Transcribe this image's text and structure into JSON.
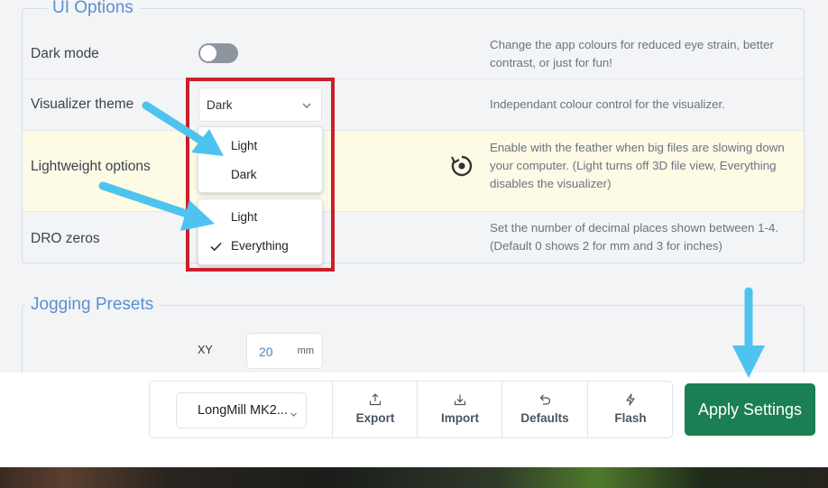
{
  "ui_options": {
    "legend": "UI Options",
    "dark_mode": {
      "label": "Dark mode",
      "description": "Change the app colours for reduced eye strain, better contrast, or just for fun!",
      "enabled": false
    },
    "visualizer_theme": {
      "label": "Visualizer theme",
      "value": "Dark",
      "description": "Independant colour control for the visualizer.",
      "options": [
        "Light",
        "Dark"
      ]
    },
    "lightweight": {
      "label": "Lightweight options",
      "description": "Enable with the feather when big files are slowing down your computer. (Light turns off 3D file view, Everything disables the visualizer)",
      "options": [
        "Light",
        "Everything"
      ],
      "selected": "Everything"
    },
    "dro_zeros": {
      "label": "DRO zeros",
      "description": "Set the number of decimal places shown between 1-4. (Default 0 shows 2 for mm and 3 for inches)"
    }
  },
  "jogging": {
    "legend": "Jogging Presets",
    "xy_label": "XY",
    "xy_value": "20",
    "unit": "mm"
  },
  "toolbar": {
    "machine": "LongMill MK2...",
    "export": "Export",
    "import": "Import",
    "defaults": "Defaults",
    "flash": "Flash",
    "apply": "Apply Settings"
  },
  "colors": {
    "accent": "#5b8fd0",
    "apply": "#1a7f52",
    "highlight_row": "#fdfbe6",
    "annotation_box": "#cb1f2b",
    "annotation_arrow": "#4fc3ef"
  }
}
